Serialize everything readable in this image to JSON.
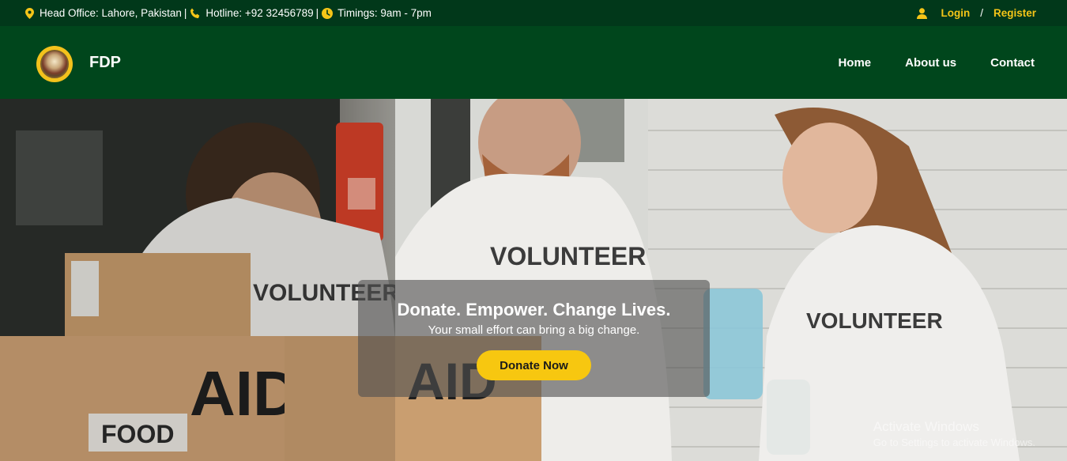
{
  "topbar": {
    "head_office": "Head Office: Lahore, Pakistan",
    "hotline": "Hotline: +92 32456789",
    "timings": "Timings: 9am - 7pm",
    "separator": "|",
    "login": "Login",
    "slash": "/",
    "register": "Register"
  },
  "navbar": {
    "brand": "FDP",
    "links": [
      "Home",
      "About us",
      "Contact"
    ]
  },
  "hero": {
    "headline": "Donate. Empower. Change Lives.",
    "subtext": "Your small effort can bring a big change.",
    "cta": "Donate Now",
    "shirt_text": "VOLUNTEER",
    "box_text_1": "AID",
    "box_text_2": "FOOD"
  },
  "watermark": {
    "line1": "Activate Windows",
    "line2": "Go to Settings to activate Windows."
  },
  "colors": {
    "topbar_bg": "#01381a",
    "navbar_bg": "#00461c",
    "accent": "#f5c518",
    "cta_bg": "#f7c710"
  }
}
